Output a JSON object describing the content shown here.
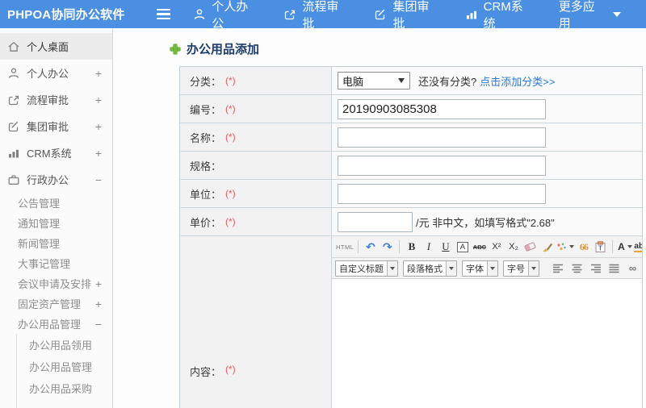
{
  "header": {
    "logo": "PHPOA协同办公软件",
    "nav": [
      {
        "label": "个人办公"
      },
      {
        "label": "流程审批"
      },
      {
        "label": "集团审批"
      },
      {
        "label": "CRM系统"
      },
      {
        "label": "更多应用"
      }
    ]
  },
  "sidebar": {
    "items": [
      {
        "label": "个人桌面",
        "expand": ""
      },
      {
        "label": "个人办公",
        "expand": "+"
      },
      {
        "label": "流程审批",
        "expand": "+"
      },
      {
        "label": "集团审批",
        "expand": "+"
      },
      {
        "label": "CRM系统",
        "expand": "+"
      },
      {
        "label": "行政办公",
        "expand": "−"
      },
      {
        "label": "公告管理",
        "expand": ""
      },
      {
        "label": "通知管理",
        "expand": ""
      },
      {
        "label": "新闻管理",
        "expand": ""
      },
      {
        "label": "大事记管理",
        "expand": ""
      },
      {
        "label": "会议申请及安排",
        "expand": "+"
      },
      {
        "label": "固定资产管理",
        "expand": "+"
      },
      {
        "label": "办公用品管理",
        "expand": "−"
      },
      {
        "label": "办公用品领用",
        "expand": ""
      },
      {
        "label": "办公用品管理",
        "expand": ""
      },
      {
        "label": "办公用品采购",
        "expand": ""
      }
    ]
  },
  "page": {
    "title": "办公用品添加"
  },
  "form": {
    "category": {
      "label": "分类：",
      "req": "(*)",
      "value": "电脑",
      "hint": "还没有分类?",
      "link": "点击添加分类>>"
    },
    "code": {
      "label": "编号：",
      "req": "(*)",
      "value": "20190903085308"
    },
    "name": {
      "label": "名称：",
      "req": "(*)",
      "value": ""
    },
    "spec": {
      "label": "规格：",
      "req": "",
      "value": ""
    },
    "unit": {
      "label": "单位：",
      "req": "(*)",
      "value": ""
    },
    "price": {
      "label": "单价：",
      "req": "(*)",
      "value": "",
      "suffix": "/元 非中文，如填写格式\"2.68\""
    },
    "content": {
      "label": "内容：",
      "req": "(*)"
    }
  },
  "editor": {
    "source": "HTML",
    "undo": "↶",
    "redo": "↷",
    "bold": "B",
    "italic": "I",
    "underline": "U",
    "font_box": "A",
    "strike": "ABC",
    "superscript": "X²",
    "subscript": "X₂",
    "quote": "66",
    "paste_letter": "T",
    "font_color": "A",
    "highlight": "ab",
    "link_glyph": "∞",
    "dropdowns": [
      "自定义标题",
      "段落格式",
      "字体",
      "字号"
    ]
  },
  "colors": {
    "header_bg": "#4a8fe1",
    "link_blue": "#2a7ad2",
    "required_red": "#e9595c",
    "title_navy": "#1c3c6e",
    "plus_green": "#72bd3d"
  }
}
